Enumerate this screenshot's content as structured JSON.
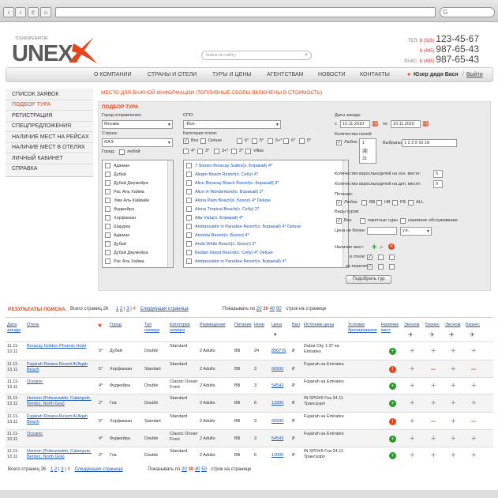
{
  "browser": {
    "back": "‹",
    "fwd": "›",
    "reload": "c",
    "home": "⌂",
    "search_glyph": "G"
  },
  "header": {
    "logo_small": "TOUROPERATOR",
    "logo_big": "UNEX",
    "search_placeholder": "поиск по сайту",
    "phones": [
      {
        "label": "ТЕЛ:",
        "code": "8 (926)",
        "num": "123-45-67"
      },
      {
        "label": "",
        "code": "8 (495)",
        "num": "987-65-43"
      },
      {
        "label": "ФАКС:",
        "code": "8 (495)",
        "num": "987-65-43"
      }
    ]
  },
  "nav": {
    "items": [
      "О КОМПАНИИ",
      "СТРАНЫ И ОТЕЛИ",
      "ТУРЫ И ЦЕНЫ",
      "АГЕНТСТВАМ",
      "НОВОСТИ",
      "КОНТАКТЫ"
    ],
    "user": "Юзер дядя Вася",
    "logout": "Выйти"
  },
  "sidebar": {
    "items": [
      "СПИСОК ЗАЯВОК",
      "ПОДБОР ТУРА",
      "РЕГИСТРАЦИЯ",
      "СПЕЦПРЕДЛОЖЕНИЯ",
      "НАЛИЧИЕ МЕСТ НА РЕЙСАХ",
      "НАЛИЧИЕ МЕСТ В ОТЕЛЯХ",
      "ЛИЧНЫЙ КАБИНЕТ",
      "СПРАВКА"
    ]
  },
  "notice": "МЕСТО ДЛЯ ВАЖНОЙ ИНФОРМАЦИИ (ТОПЛИВНЫЕ СБОРЫ ВКЛЮЧЕНЫ В СТОИМОСТЬ)",
  "form": {
    "title": "ПОДБОР ТУРА",
    "departure_label": "Город отправления:",
    "departure_value": "Москва",
    "spo_label": "СПО:",
    "spo_value": "-Все-",
    "country_label": "Страна:",
    "country_value": "ОАЭ",
    "hotelcat_label": "Категория отеля:",
    "hotelcats": [
      "Все",
      "Deluxe",
      "6*",
      "5*",
      "5+*",
      "6*",
      "5*",
      "4*",
      "3*",
      "3+*",
      "2*",
      "Villas"
    ],
    "city_label": "Город:",
    "city_any": "любой",
    "cities": [
      "Аджман",
      "Дубай",
      "Дубай Джумейра",
      "Рас Аль Хайма",
      "Умм Аль Кайвайн",
      "Фуджейра",
      "Хорфаккан",
      "Шарджа",
      "Аджман",
      "Дубай",
      "Дубай Джумейра",
      "Рас Аль Хайма"
    ],
    "hotels": [
      "7 Stones Boracay Suites(о. Боракай) 4*",
      "Alegre Beach Resort(о. Себу) 4*",
      "Alice Boracay Beach Resort(о. Боракай) 3*",
      "Alice in Wonderland(о. Боракай) 2*",
      "Alona Palm Beach(о. Бохол) 4* Deluxe",
      "Alona Tropical Beach(о. Себу) 2*",
      "Alta Vista(о. Боракай) 4*",
      "Ambassador in Paradise Resort(о. Боракай) 4* Deluxe",
      "Amorita Resort(о. Бохол) 4*",
      "Anda White Beach(о. Бохол) 3*",
      "Badian Island Resort(о. Себу) 4* Deluxe",
      "Ambassador in Paradise Resort(о. Боракай) 4*"
    ],
    "dates_label": "Даты заезда:",
    "from_label": "с",
    "from_value": "10.11.2010",
    "to_label": "по",
    "to_value": "10.11.2010",
    "nights_label": "Количество ночей:",
    "nights_any": "Любое",
    "nights_options": [
      "1",
      "2",
      "31"
    ],
    "selected_label": "Выбраны:",
    "selected_value": "1 2 3 9 16 18",
    "adults_label": "Количество взрослых/детей на осн. месте:",
    "adults_value": "5",
    "extra_label": "Количество взрослых/детей на доп. месте:",
    "extra_value": "0",
    "meals_label": "Питание:",
    "meals": [
      "Любое",
      "BB",
      "HB",
      "FB",
      "ALL"
    ],
    "tourtype_label": "Виды туров:",
    "tourtypes": [
      "Все",
      "пакетные туры",
      "наземное обслуживание"
    ],
    "price_label": "Цена не более:",
    "currency": "у.е.",
    "avail_label": "Наличие мест:",
    "hotel_avail_label": "в отеле:",
    "flight_avail_label": "на перелет:",
    "search_button": "Подобрать тур"
  },
  "results": {
    "title": "РЕЗУЛЬТАТЫ ПОИСКА:",
    "total": "Всего страниц 26",
    "pages": [
      "1",
      "2",
      "3",
      "4"
    ],
    "next": "Следующая страница",
    "show_label": "Показывать по",
    "per_page": [
      "20",
      "30",
      "40",
      "50"
    ],
    "per_suffix": "строк на странице"
  },
  "table": {
    "headers": [
      "Дата заезда",
      "Отель",
      "★",
      "Город",
      "Тип номера",
      "Категория номера",
      "Размещение",
      "Питание",
      "Ночи",
      "Цена",
      "Вал",
      "Источник цены",
      "Условие бронирования",
      "Наличие мест",
      "Эконом",
      "Бизнес",
      "Эконом",
      "Бизнес"
    ],
    "rows": [
      {
        "date": "11.11-13.11",
        "hotel": "Boracay Golden Phoenix Hotel",
        "star": "5*",
        "city": "Дубай",
        "type": "Double",
        "cat": "Standard",
        "place": "2 Adults",
        "meal": "BB",
        "nights": "24",
        "price": "896776",
        "cur": "₽",
        "src": "Dubai City 1-3* на Emirates",
        "avail": "g",
        "f": [
          "+",
          "+",
          "+",
          "+"
        ]
      },
      {
        "date": "11.11-13.11",
        "hotel": "Fujairah Rotana Resort Al Aqah Beach",
        "star": "5*",
        "city": "Хорфаккан",
        "type": "Standart",
        "cat": "Standard",
        "place": "2 Adults",
        "meal": "BB",
        "nights": "3",
        "price": "66500",
        "cur": "₽",
        "src": "Fujairah на Emirates",
        "avail": "r",
        "f": [
          "+",
          "-",
          "+",
          "-"
        ]
      },
      {
        "date": "11.11-13.11",
        "hotel": "Oceanic",
        "star": "4*",
        "city": "Фуджейра",
        "type": "Double",
        "cat": "Classic Ocean Front",
        "place": "2 Adults",
        "meal": "BB",
        "nights": "3",
        "price": "54543",
        "cur": "₽",
        "src": "Fujairah на Emirates",
        "avail": "g",
        "f": [
          "+",
          "+",
          "+",
          "+"
        ]
      },
      {
        "date": "11.11-13.11",
        "hotel": "Horizon (Pobravaddo, Calangute, Berdez, North Goa)",
        "star": "2*",
        "city": "Гоа",
        "type": "Double",
        "cat": "Standard",
        "place": "2 Adults",
        "meal": "BB",
        "nights": "6",
        "price": "12000",
        "cur": "₽",
        "src": "IN SPO#5 Гоа 24.11 Трансаэро",
        "avail": "g",
        "f": [
          "+",
          "+",
          "+",
          "+"
        ]
      },
      {
        "date": "11.11-13.11",
        "hotel": "Fujairah Rotana Resort Al Aqah Beach",
        "star": "5*",
        "city": "Хорфаккан",
        "type": "Standart",
        "cat": "Standard",
        "place": "2 Adults",
        "meal": "BB",
        "nights": "3",
        "price": "66500",
        "cur": "₽",
        "src": "Fujairah на Emirates",
        "avail": "r",
        "f": [
          "+",
          "-",
          "+",
          "-"
        ]
      },
      {
        "date": "11.11-13.11",
        "hotel": "Oceanic",
        "star": "4*",
        "city": "Фуджейра",
        "type": "Double",
        "cat": "Classic Ocean Front",
        "place": "2 Adults",
        "meal": "BB",
        "nights": "3",
        "price": "54543",
        "cur": "₽",
        "src": "Fujairah на Emirates",
        "avail": "g",
        "f": [
          "+",
          "+",
          "+",
          "+"
        ]
      },
      {
        "date": "11.11-13.11",
        "hotel": "Horizon (Pobravaddo, Calangute, Berdez, North Goa)",
        "star": "2*",
        "city": "Гоа",
        "type": "Double",
        "cat": "Standard",
        "place": "2 Adults",
        "meal": "BB",
        "nights": "6",
        "price": "12000",
        "cur": "₽",
        "src": "IN SPO#5 Гоа 24.11 Трансаэро",
        "avail": "g",
        "f": [
          "+",
          "+",
          "+",
          "+"
        ]
      }
    ]
  },
  "colors": {
    "accent": "#e2461b",
    "link": "#1a55b4",
    "green": "#2b9a2b"
  }
}
